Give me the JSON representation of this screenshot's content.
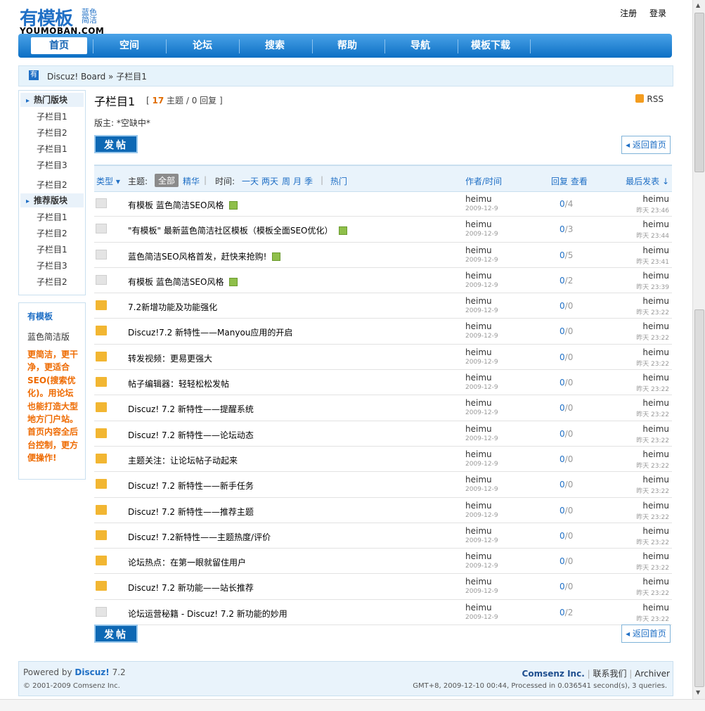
{
  "logo": {
    "cn": "有模板",
    "sub": "蓝色简洁",
    "en": "YOUMOBAN.COM"
  },
  "toplinks": {
    "register": "注册",
    "login": "登录"
  },
  "nav": [
    "首页",
    "空间",
    "论坛",
    "搜索",
    "帮助",
    "导航",
    "模板下载"
  ],
  "breadcrumb": "Discuz! Board » 子栏目1",
  "sidebar": {
    "hot_title": "热门版块",
    "hot_items": [
      "子栏目1",
      "子栏目2",
      "子栏目1",
      "子栏目3",
      "子栏目2"
    ],
    "rec_title": "推荐版块",
    "rec_items": [
      "子栏目1",
      "子栏目2",
      "子栏目1",
      "子栏目3",
      "子栏目2"
    ],
    "promo_title": "有模板",
    "promo_sub": "蓝色简洁版",
    "promo_text": "更简洁，更干净，更适合SEO(搜索优化)。用论坛也能打造大型地方门户站。首页内容全后台控制，更方便操作!"
  },
  "forum": {
    "title": "子栏目1",
    "topics_count": "17",
    "topics_label": "主题",
    "replies_text": "/ 0 回复",
    "moderator": "版主: *空缺中*",
    "rss": "RSS",
    "post_label": "发帖",
    "back_label": "返回首页"
  },
  "thead": {
    "type": "类型",
    "topic_label": "主题:",
    "all": "全部",
    "digest": "精华",
    "time_label": "时间:",
    "t1": "一天",
    "t2": "两天",
    "t3": "周",
    "t4": "月",
    "t5": "季",
    "hot": "热门",
    "author": "作者/时间",
    "reply_view": "回复 查看",
    "lastpost": "最后发表"
  },
  "threads": [
    {
      "title": "有模板  蓝色简洁SEO风格",
      "attach": true,
      "icon": "old",
      "author": "heimu",
      "date": "2009-12-9",
      "replies": "0",
      "views": "4",
      "last_user": "heimu",
      "last_time": "昨天 23:46"
    },
    {
      "title": "\"有模板\" 最新蓝色简洁社区模板（模板全面SEO优化）",
      "attach": true,
      "icon": "old",
      "author": "heimu",
      "date": "2009-12-9",
      "replies": "0",
      "views": "3",
      "last_user": "heimu",
      "last_time": "昨天 23:44"
    },
    {
      "title": "蓝色简洁SEO风格首发，赶快来抢购!",
      "attach": true,
      "icon": "old",
      "author": "heimu",
      "date": "2009-12-9",
      "replies": "0",
      "views": "5",
      "last_user": "heimu",
      "last_time": "昨天 23:41"
    },
    {
      "title": "有模板  蓝色简洁SEO风格",
      "attach": true,
      "icon": "old",
      "author": "heimu",
      "date": "2009-12-9",
      "replies": "0",
      "views": "2",
      "last_user": "heimu",
      "last_time": "昨天 23:39"
    },
    {
      "title": "7.2新增功能及功能强化",
      "attach": false,
      "icon": "new",
      "author": "heimu",
      "date": "2009-12-9",
      "replies": "0",
      "views": "0",
      "last_user": "heimu",
      "last_time": "昨天 23:22"
    },
    {
      "title": "Discuz!7.2 新特性——Manyou应用的开启",
      "attach": false,
      "icon": "new",
      "author": "heimu",
      "date": "2009-12-9",
      "replies": "0",
      "views": "0",
      "last_user": "heimu",
      "last_time": "昨天 23:22"
    },
    {
      "title": "转发视频：更易更强大",
      "attach": false,
      "icon": "new",
      "author": "heimu",
      "date": "2009-12-9",
      "replies": "0",
      "views": "0",
      "last_user": "heimu",
      "last_time": "昨天 23:22"
    },
    {
      "title": "帖子编辑器：轻轻松松发帖",
      "attach": false,
      "icon": "new",
      "author": "heimu",
      "date": "2009-12-9",
      "replies": "0",
      "views": "0",
      "last_user": "heimu",
      "last_time": "昨天 23:22"
    },
    {
      "title": "Discuz! 7.2 新特性——提醒系统",
      "attach": false,
      "icon": "new",
      "author": "heimu",
      "date": "2009-12-9",
      "replies": "0",
      "views": "0",
      "last_user": "heimu",
      "last_time": "昨天 23:22"
    },
    {
      "title": "Discuz! 7.2 新特性——论坛动态",
      "attach": false,
      "icon": "new",
      "author": "heimu",
      "date": "2009-12-9",
      "replies": "0",
      "views": "0",
      "last_user": "heimu",
      "last_time": "昨天 23:22"
    },
    {
      "title": "主题关注：让论坛帖子动起来",
      "attach": false,
      "icon": "new",
      "author": "heimu",
      "date": "2009-12-9",
      "replies": "0",
      "views": "0",
      "last_user": "heimu",
      "last_time": "昨天 23:22"
    },
    {
      "title": "Discuz! 7.2 新特性——新手任务",
      "attach": false,
      "icon": "new",
      "author": "heimu",
      "date": "2009-12-9",
      "replies": "0",
      "views": "0",
      "last_user": "heimu",
      "last_time": "昨天 23:22"
    },
    {
      "title": "Discuz! 7.2 新特性——推荐主题",
      "attach": false,
      "icon": "new",
      "author": "heimu",
      "date": "2009-12-9",
      "replies": "0",
      "views": "0",
      "last_user": "heimu",
      "last_time": "昨天 23:22"
    },
    {
      "title": "Discuz! 7.2新特性——主题热度/评价",
      "attach": false,
      "icon": "new",
      "author": "heimu",
      "date": "2009-12-9",
      "replies": "0",
      "views": "0",
      "last_user": "heimu",
      "last_time": "昨天 23:22"
    },
    {
      "title": "论坛热点：在第一眼就留住用户",
      "attach": false,
      "icon": "new",
      "author": "heimu",
      "date": "2009-12-9",
      "replies": "0",
      "views": "0",
      "last_user": "heimu",
      "last_time": "昨天 23:22"
    },
    {
      "title": "Discuz! 7.2 新功能——站长推荐",
      "attach": false,
      "icon": "new",
      "author": "heimu",
      "date": "2009-12-9",
      "replies": "0",
      "views": "0",
      "last_user": "heimu",
      "last_time": "昨天 23:22"
    },
    {
      "title": "论坛运营秘籍 - Discuz! 7.2 新功能的妙用",
      "attach": false,
      "icon": "old",
      "author": "heimu",
      "date": "2009-12-9",
      "replies": "0",
      "views": "2",
      "last_user": "heimu",
      "last_time": "昨天 23:22"
    }
  ],
  "footer": {
    "powered": "Powered by",
    "product": "Discuz!",
    "version": "7.2",
    "copyright": "© 2001-2009 Comsenz Inc.",
    "company": "Comsenz Inc.",
    "contact": "联系我们",
    "archiver": "Archiver",
    "gmt": "GMT+8, 2009-12-10 00:44, Processed in 0.036541 second(s), 3 queries."
  },
  "colors": {
    "accent": "#1f6fc5",
    "nav": "#0c6fc4",
    "orange": "#ee6a00"
  }
}
